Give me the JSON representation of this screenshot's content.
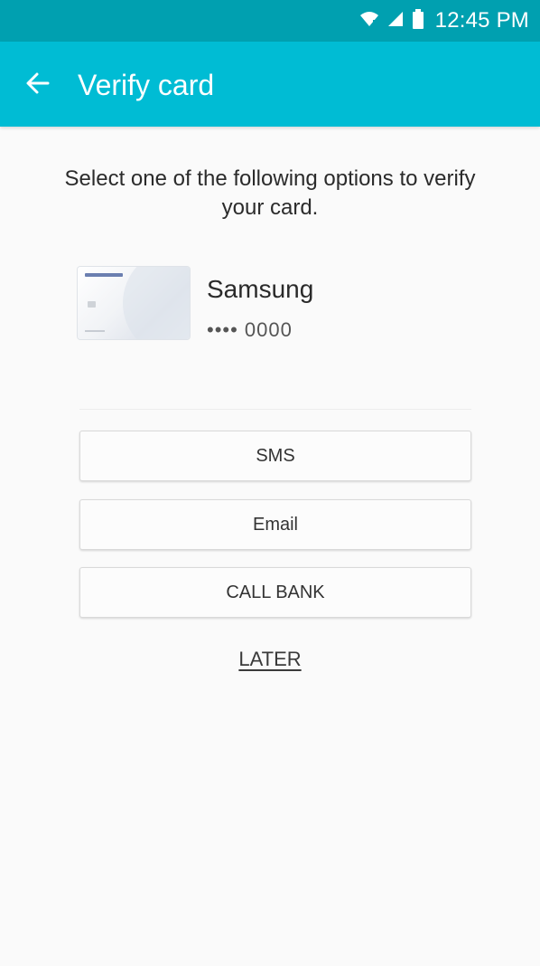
{
  "status_bar": {
    "time": "12:45 PM",
    "icons": [
      "wifi-icon",
      "signal-icon",
      "battery-icon"
    ]
  },
  "app_bar": {
    "title": "Verify card",
    "back_icon": "arrow-left-icon"
  },
  "main": {
    "instruction": "Select one of the following options to verify your card.",
    "card": {
      "name": "Samsung",
      "masked_number": "•••• 0000"
    },
    "options": [
      {
        "label": "SMS"
      },
      {
        "label": "Email"
      },
      {
        "label": "CALL BANK"
      }
    ],
    "later_label": "LATER"
  },
  "colors": {
    "status_bar": "#00a0b0",
    "app_bar": "#00bcd4",
    "background": "#fafafa"
  }
}
